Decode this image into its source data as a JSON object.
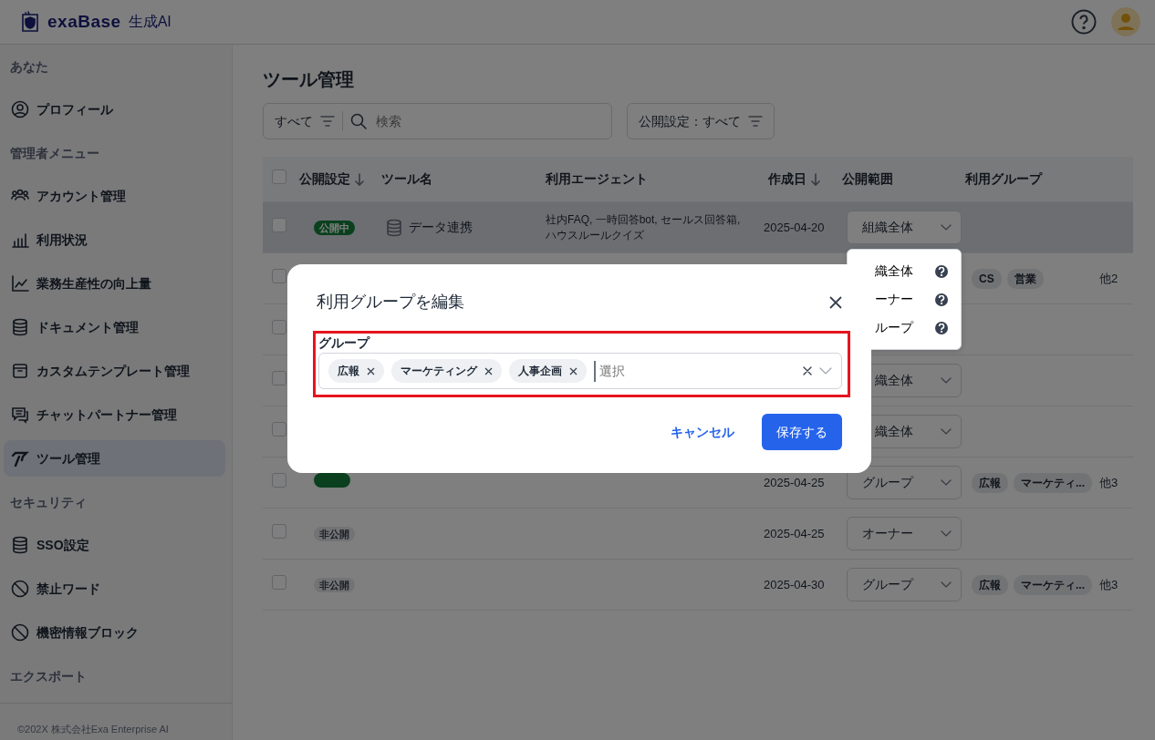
{
  "header": {
    "logo_name": "exaBase",
    "logo_suffix": "生成AI"
  },
  "sidebar": {
    "sections": [
      {
        "heading": "あなた",
        "items": [
          {
            "label": "プロフィール",
            "selected": false
          }
        ]
      },
      {
        "heading": "管理者メニュー",
        "items": [
          {
            "label": "アカウント管理",
            "selected": false
          },
          {
            "label": "利用状況",
            "selected": false
          },
          {
            "label": "業務生産性の向上量",
            "selected": false
          },
          {
            "label": "ドキュメント管理",
            "selected": false
          },
          {
            "label": "カスタムテンプレート管理",
            "selected": false
          },
          {
            "label": "チャットパートナー管理",
            "selected": false
          },
          {
            "label": "ツール管理",
            "selected": true
          }
        ]
      },
      {
        "heading": "セキュリティ",
        "items": [
          {
            "label": "SSO設定",
            "selected": false
          },
          {
            "label": "禁止ワード",
            "selected": false
          },
          {
            "label": "機密情報ブロック",
            "selected": false
          }
        ]
      },
      {
        "heading": "エクスポート"
      }
    ],
    "footer": "©202X 株式会社Exa Enterprise AI"
  },
  "page": {
    "title": "ツール管理",
    "scope_filter": "すべて",
    "search": {
      "placeholder": "検索"
    },
    "visibility_filter": "公開設定：すべて"
  },
  "table": {
    "select_all": {
      "checked": false
    },
    "columns": [
      {
        "label": "公開設定",
        "sortable": true
      },
      {
        "label": "ツール名",
        "sortable": false
      },
      {
        "label": "利用エージェント",
        "sortable": false
      },
      {
        "label": "作成日",
        "sortable": true
      },
      {
        "label": "公開範囲",
        "sortable": false
      },
      {
        "label": "利用グループ",
        "sortable": false
      }
    ],
    "rows": [
      {
        "hovered": true,
        "checked": false,
        "status": {
          "label": "公開中",
          "kind": "public"
        },
        "name": "データ連携",
        "agents": "社内FAQ, 一時回答bot, セールス回答箱, ハウスルールクイズ",
        "date": "2025-04-20",
        "scope": "組織全体"
      },
      {
        "hovered": false,
        "checked": false,
        "groups": [
          "CS",
          "営業"
        ],
        "more": "他2"
      },
      {
        "hovered": false,
        "checked": false
      },
      {
        "hovered": false,
        "checked": false,
        "scope": "織全体"
      },
      {
        "hovered": false,
        "checked": false,
        "scope": "織全体"
      },
      {
        "hovered": false,
        "checked": false,
        "status": {
          "kind": "public"
        },
        "date": "2025-04-25",
        "scope": "グループ",
        "groups": [
          "広報",
          "マーケティ..."
        ],
        "more": "他3"
      },
      {
        "hovered": false,
        "checked": false,
        "status": {
          "label": "非公開",
          "kind": "private"
        },
        "date": "2025-04-25",
        "scope": "オーナー"
      },
      {
        "hovered": false,
        "checked": false,
        "status": {
          "label": "非公開",
          "kind": "private"
        },
        "date": "2025-04-30",
        "scope": "グループ",
        "groups": [
          "広報",
          "マーケティ..."
        ],
        "more": "他3"
      }
    ]
  },
  "scope_menu": {
    "items": [
      {
        "label": "織全体"
      },
      {
        "label": "ーナー"
      },
      {
        "label": "ループ"
      }
    ]
  },
  "modal": {
    "title": "利用グループを編集",
    "field_label": "グループ",
    "tags": [
      "広報",
      "マーケティング",
      "人事企画"
    ],
    "placeholder": "選択",
    "cancel": "キャンセル",
    "save": "保存する"
  }
}
